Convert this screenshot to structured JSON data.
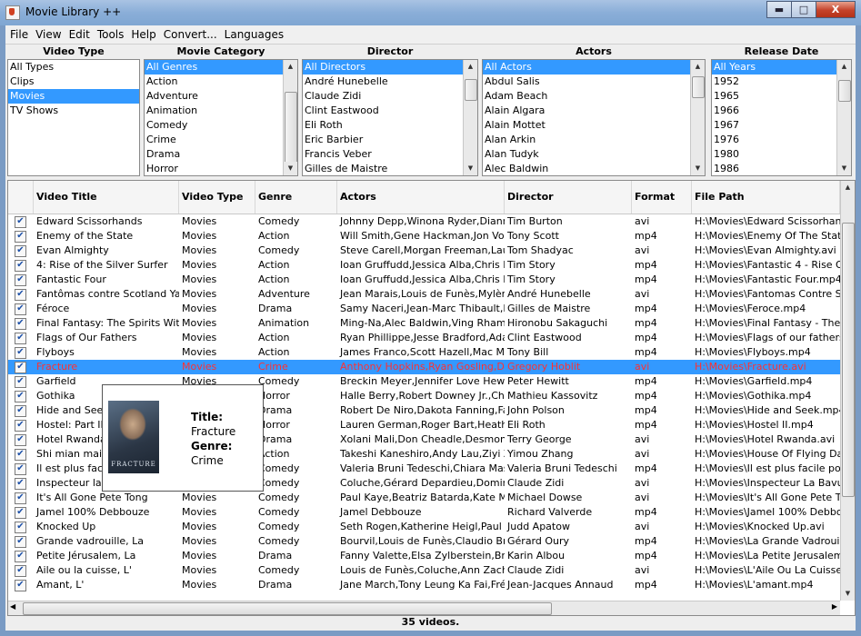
{
  "window": {
    "title": "Movie Library ++",
    "minimize": "▬",
    "maximize": "□",
    "close": "X"
  },
  "menu": [
    "File",
    "View",
    "Edit",
    "Tools",
    "Help",
    "Convert...",
    "Languages"
  ],
  "filters": {
    "video_type": {
      "header": "Video Type",
      "items": [
        "All Types",
        "Clips",
        "Movies",
        "TV Shows"
      ],
      "selected": "Movies"
    },
    "category": {
      "header": "Movie Category",
      "items": [
        "All Genres",
        "Action",
        "Adventure",
        "Animation",
        "Comedy",
        "Crime",
        "Drama",
        "Horror"
      ],
      "selected": "All Genres"
    },
    "director": {
      "header": "Director",
      "items": [
        "All Directors",
        "André Hunebelle",
        "Claude Zidi",
        "Clint Eastwood",
        "Eli Roth",
        "Eric Barbier",
        "Francis Veber",
        "Gilles de Maistre"
      ],
      "selected": "All Directors"
    },
    "actors": {
      "header": "Actors",
      "items": [
        "All Actors",
        "Abdul Salis",
        "Adam Beach",
        "Alain Algara",
        "Alain Mottet",
        "Alan Arkin",
        "Alan Tudyk",
        "Alec Baldwin"
      ],
      "selected": "All Actors"
    },
    "release": {
      "header": "Release Date",
      "items": [
        "All Years",
        "1952",
        "1965",
        "1966",
        "1967",
        "1976",
        "1980",
        "1986"
      ],
      "selected": "All Years"
    }
  },
  "table": {
    "columns": [
      "Video Title",
      "Video Type",
      "Genre",
      "Actors",
      "Director",
      "Format",
      "File Path"
    ],
    "rows": [
      [
        "Edward Scissorhands",
        "Movies",
        "Comedy",
        "Johnny Depp,Winona Ryder,Diann...",
        "Tim Burton",
        "avi",
        "H:\\Movies\\Edward Scissorhands"
      ],
      [
        "Enemy of the State",
        "Movies",
        "Action",
        "Will Smith,Gene Hackman,Jon Voigh...",
        "Tony Scott",
        "mp4",
        "H:\\Movies\\Enemy Of The State.m"
      ],
      [
        "Evan Almighty",
        "Movies",
        "Comedy",
        "Steve Carell,Morgan Freeman,Laur...",
        "Tom Shadyac",
        "avi",
        "H:\\Movies\\Evan Almighty.avi"
      ],
      [
        "4: Rise of the Silver Surfer",
        "Movies",
        "Action",
        "Ioan Gruffudd,Jessica Alba,Chris E...",
        "Tim Story",
        "mp4",
        "H:\\Movies\\Fantastic 4 - Rise Of T"
      ],
      [
        "Fantastic Four",
        "Movies",
        "Action",
        "Ioan Gruffudd,Jessica Alba,Chris E...",
        "Tim Story",
        "mp4",
        "H:\\Movies\\Fantastic Four.mp4"
      ],
      [
        "Fantômas contre Scotland Yard",
        "Movies",
        "Adventure",
        "Jean Marais,Louis de Funès,Mylène...",
        "André Hunebelle",
        "avi",
        "H:\\Movies\\Fantomas Contre Sco"
      ],
      [
        "Féroce",
        "Movies",
        "Drama",
        "Samy Naceri,Jean-Marc Thibault,Be...",
        "Gilles de Maistre",
        "mp4",
        "H:\\Movies\\Feroce.mp4"
      ],
      [
        "Final Fantasy: The Spirits Within",
        "Movies",
        "Animation",
        "Ming-Na,Alec Baldwin,Ving Rhames...",
        "Hironobu Sakaguchi",
        "mp4",
        "H:\\Movies\\Final Fantasy - The S"
      ],
      [
        "Flags of Our Fathers",
        "Movies",
        "Action",
        "Ryan Phillippe,Jesse Bradford,Ada...",
        "Clint Eastwood",
        "mp4",
        "H:\\Movies\\Flags of our fathers.m"
      ],
      [
        "Flyboys",
        "Movies",
        "Action",
        "James Franco,Scott Hazell,Mac Mc...",
        "Tony Bill",
        "mp4",
        "H:\\Movies\\Flyboys.mp4"
      ],
      [
        "Fracture",
        "Movies",
        "Crime",
        "Anthony Hopkins,Ryan Gosling,Dav...",
        "Gregory Hoblit",
        "avi",
        "H:\\Movies\\Fracture.avi"
      ],
      [
        "Garfield",
        "Movies",
        "Comedy",
        "Breckin Meyer,Jennifer Love Hewitt...",
        "Peter Hewitt",
        "mp4",
        "H:\\Movies\\Garfield.mp4"
      ],
      [
        "Gothika",
        "Movies",
        "Horror",
        "Halle Berry,Robert Downey Jr.,Cha...",
        "Mathieu Kassovitz",
        "mp4",
        "H:\\Movies\\Gothika.mp4"
      ],
      [
        "Hide and Seek",
        "Movies",
        "Drama",
        "Robert De Niro,Dakota Fanning,Fa...",
        "John Polson",
        "mp4",
        "H:\\Movies\\Hide and Seek.mp4"
      ],
      [
        "Hostel: Part II",
        "Movies",
        "Horror",
        "Lauren German,Roger Bart,Heathe...",
        "Eli Roth",
        "mp4",
        "H:\\Movies\\Hostel II.mp4"
      ],
      [
        "Hotel Rwanda",
        "Movies",
        "Drama",
        "Xolani Mali,Don Cheadle,Desmond ...",
        "Terry George",
        "avi",
        "H:\\Movies\\Hotel Rwanda.avi"
      ],
      [
        "Shi mian mai fu",
        "Movies",
        "Action",
        "Takeshi Kaneshiro,Andy Lau,Ziyi Zh...",
        "Yimou Zhang",
        "avi",
        "H:\\Movies\\House Of Flying Dagg"
      ],
      [
        "Il est plus facile",
        "Movies",
        "Comedy",
        "Valeria Bruni Tedeschi,Chiara Mastr...",
        "Valeria Bruni Tedeschi",
        "mp4",
        "H:\\Movies\\Il est plus facile pour"
      ],
      [
        "Inspecteur la B",
        "Movies",
        "Comedy",
        "Coluche,Gérard Depardieu,Dominiq...",
        "Claude Zidi",
        "avi",
        "H:\\Movies\\Inspecteur La Bavure"
      ],
      [
        "It's All Gone Pete Tong",
        "Movies",
        "Comedy",
        "Paul Kaye,Beatriz Batarda,Kate Ma...",
        "Michael Dowse",
        "avi",
        "H:\\Movies\\It's All Gone Pete Ton"
      ],
      [
        "Jamel 100% Debbouze",
        "Movies",
        "Comedy",
        "Jamel Debbouze",
        "Richard Valverde",
        "mp4",
        "H:\\Movies\\Jamel 100% Debbouze"
      ],
      [
        "Knocked Up",
        "Movies",
        "Comedy",
        "Seth Rogen,Katherine Heigl,Paul R...",
        "Judd Apatow",
        "avi",
        "H:\\Movies\\Knocked Up.avi"
      ],
      [
        "Grande vadrouille, La",
        "Movies",
        "Comedy",
        "Bourvil,Louis de Funès,Claudio Bro...",
        "Gérard Oury",
        "mp4",
        "H:\\Movies\\La Grande Vadrouille.m"
      ],
      [
        "Petite Jérusalem, La",
        "Movies",
        "Drama",
        "Fanny Valette,Elsa Zylberstein,Bru...",
        "Karin Albou",
        "mp4",
        "H:\\Movies\\La Petite Jerusalem.m"
      ],
      [
        "Aile ou la cuisse, L'",
        "Movies",
        "Comedy",
        "Louis de Funès,Coluche,Ann Zacha...",
        "Claude Zidi",
        "avi",
        "H:\\Movies\\L'Aile Ou La Cuisse.av"
      ],
      [
        "Amant, L'",
        "Movies",
        "Drama",
        "Jane March,Tony Leung Ka Fai,Fré...",
        "Jean-Jacques Annaud",
        "mp4",
        "H:\\Movies\\L'amant.mp4"
      ]
    ],
    "selected_index": 10
  },
  "tooltip": {
    "title_label": "Title:",
    "title_value": "Fracture",
    "genre_label": "Genre:",
    "genre_value": "Crime",
    "poster_text": "FRACTURE"
  },
  "status": "35 videos."
}
